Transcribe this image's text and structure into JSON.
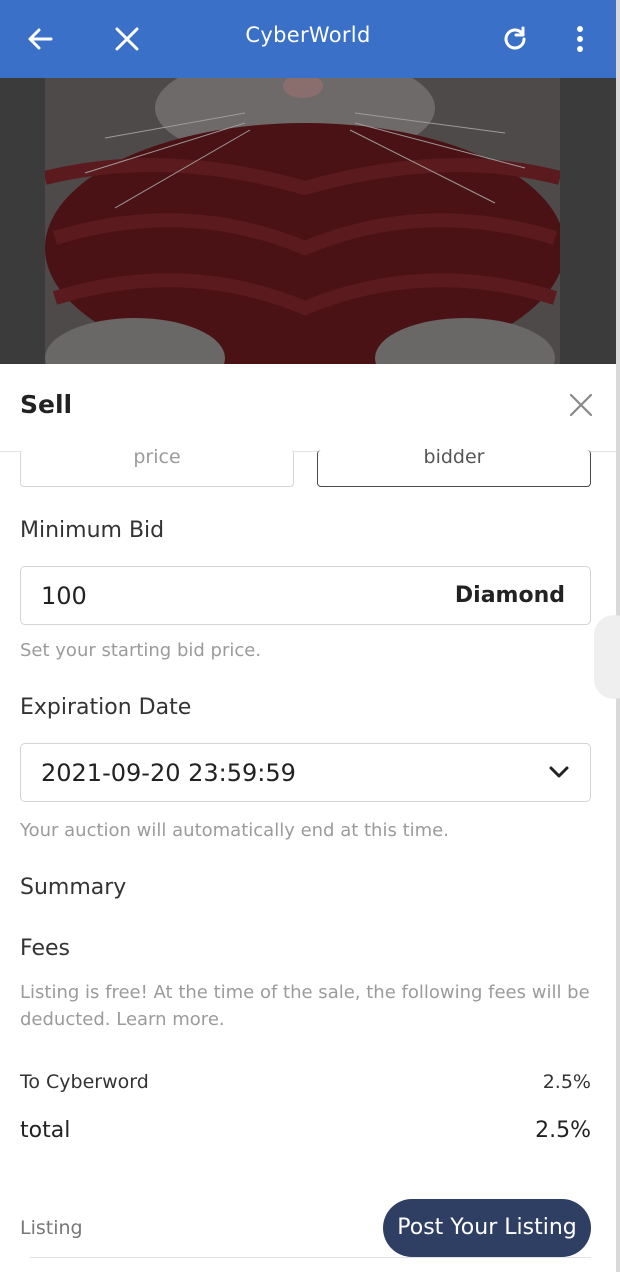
{
  "topbar": {
    "title": "CyberWorld",
    "color": "#3a70c8",
    "icons": [
      "arrow-left-icon",
      "close-icon",
      "refresh-icon",
      "more-vert-icon"
    ]
  },
  "sheet": {
    "title": "Sell",
    "segments": {
      "left": "price",
      "right": "bidder"
    },
    "min_bid": {
      "label": "Minimum Bid",
      "value": "100",
      "currency": "Diamond",
      "help": "Set your starting bid price."
    },
    "expiration": {
      "label": "Expiration Date",
      "value": "2021-09-20 23:59:59",
      "help": "Your auction will automatically end at this time."
    },
    "summary": {
      "label": "Summary",
      "fees_label": "Fees",
      "fees_text": "Listing is free! At the time of the sale, the following fees will be deducted. Learn more.",
      "rows": [
        {
          "label": "To Cyberword",
          "value": "2.5%"
        },
        {
          "label": "total",
          "value": "2.5%"
        }
      ]
    },
    "footer": {
      "listing_label": "Listing",
      "post_button": "Post Your Listing",
      "button_color": "#2f3f63"
    }
  }
}
